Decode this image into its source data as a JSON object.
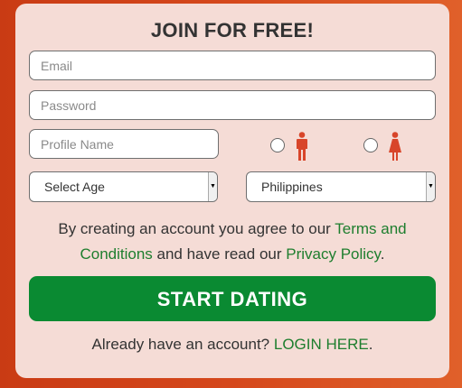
{
  "form": {
    "title": "JOIN FOR FREE!",
    "email_placeholder": "Email",
    "password_placeholder": "Password",
    "profile_name_placeholder": "Profile Name",
    "gender_options": [
      {
        "icon": "male-icon",
        "selected": false
      },
      {
        "icon": "female-icon",
        "selected": false
      }
    ],
    "age_select": "Select Age",
    "country_select": "Philippines",
    "notice_prefix": "By creating an account you agree to our ",
    "terms_link": "Terms and Conditions",
    "notice_middle": " and have read our ",
    "privacy_link": "Privacy Policy",
    "notice_suffix": ".",
    "submit_label": "START DATING",
    "login_prompt": "Already have an account? ",
    "login_link": "LOGIN HERE",
    "login_suffix": "."
  },
  "colors": {
    "background": "#d5481c",
    "card": "#f5dcd6",
    "accent": "#0a8a32",
    "link": "#1e7e2e",
    "icon": "#d8452a"
  }
}
